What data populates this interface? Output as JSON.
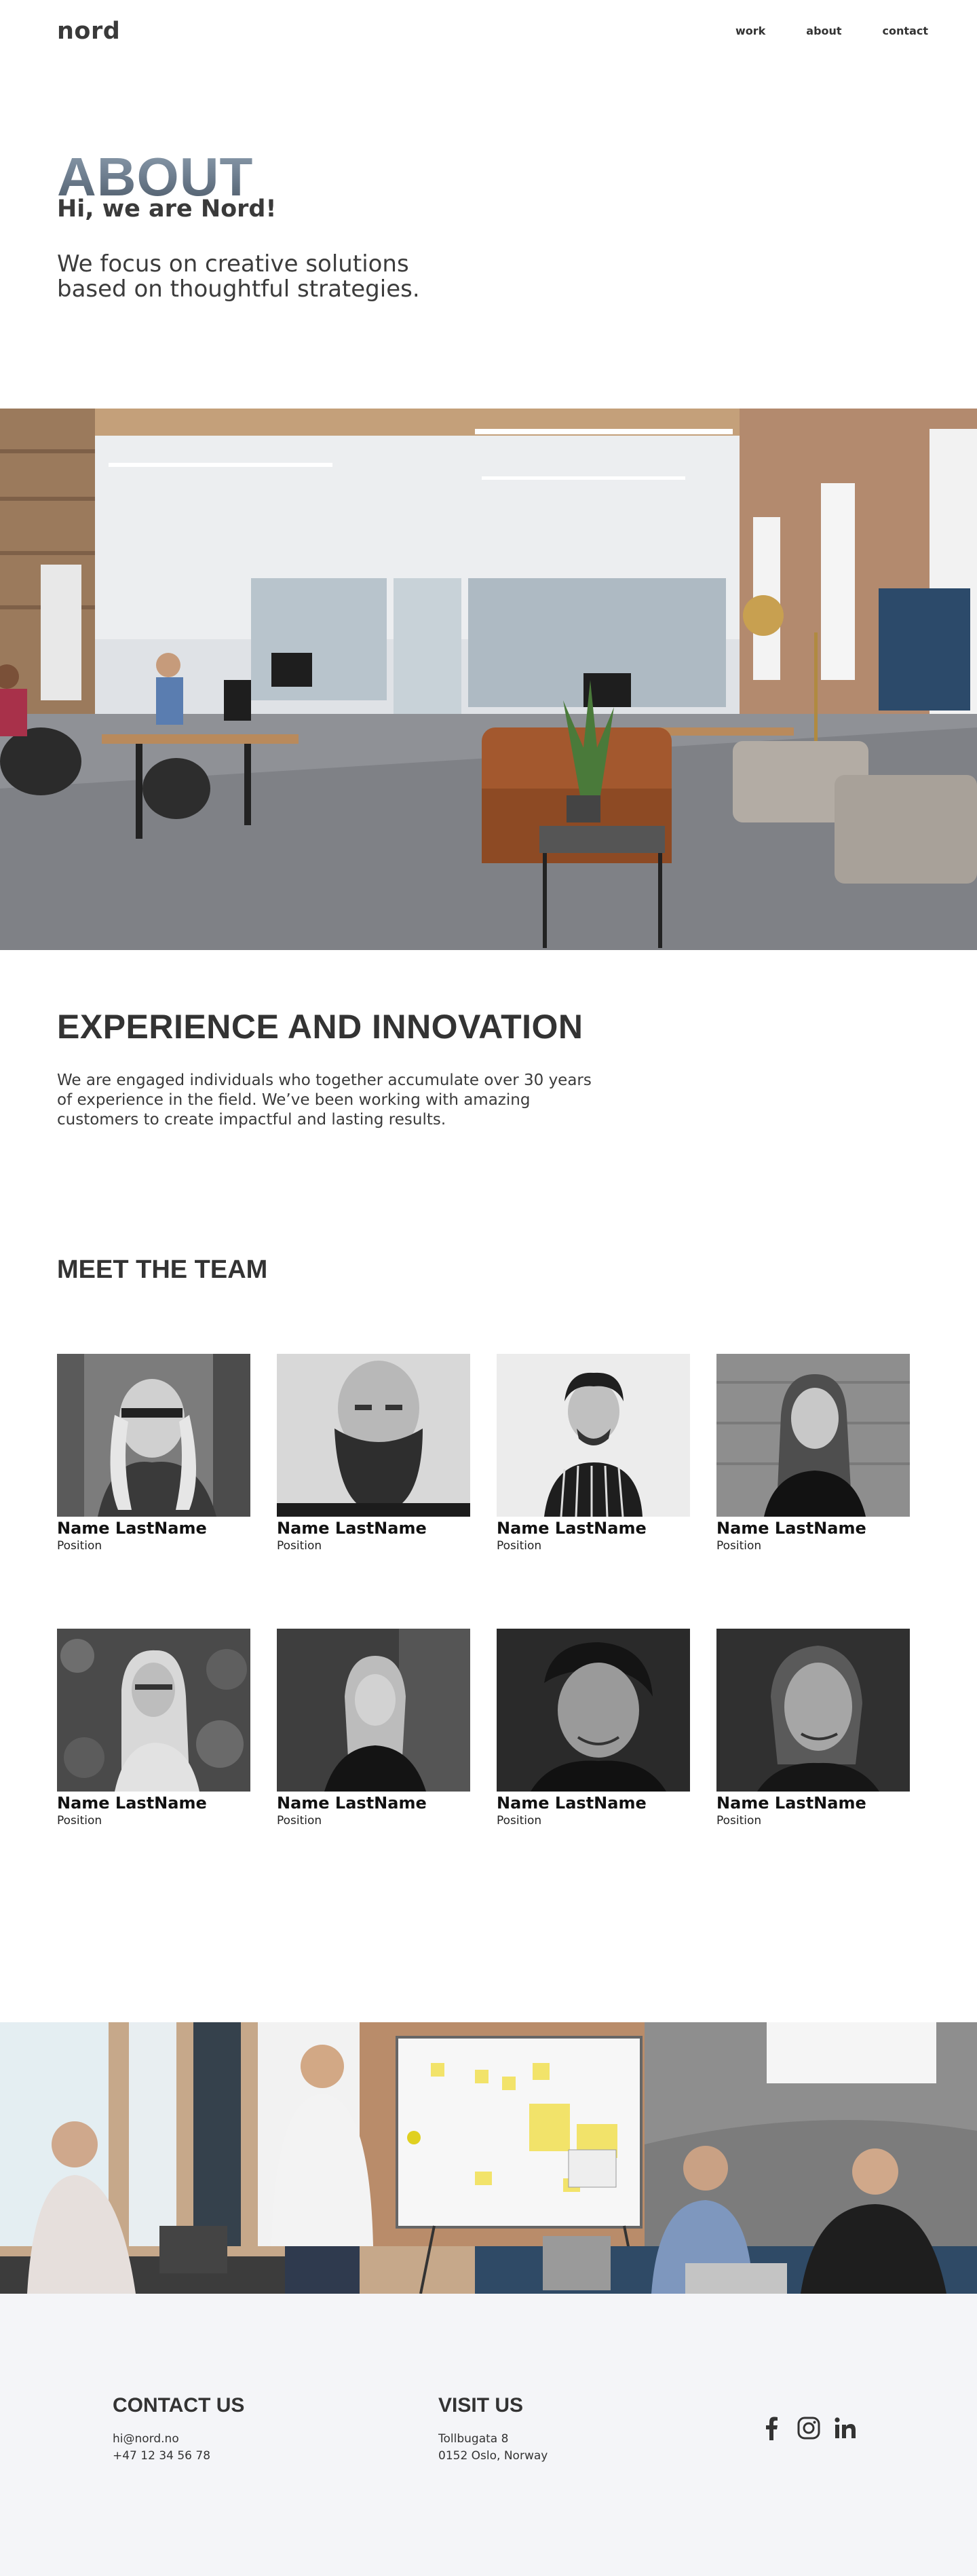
{
  "header": {
    "logo": "nord",
    "nav": [
      {
        "label": "work"
      },
      {
        "label": "about"
      },
      {
        "label": "contact"
      }
    ]
  },
  "hero": {
    "title": "ABOUT",
    "subtitle": "Hi, we are Nord!",
    "tagline": "We focus on creative solutions based on thoughtful strategies."
  },
  "office_photo": {
    "icon": "office-photo"
  },
  "experience": {
    "title": "EXPERIENCE AND INNOVATION",
    "text": "We are engaged individuals who together accumulate over 30 years of experience in the field. We’ve been working with amazing customers to create impactful and lasting results."
  },
  "team": {
    "title": "MEET THE TEAM",
    "members": [
      {
        "name": "Name LastName",
        "position": "Position"
      },
      {
        "name": "Name LastName",
        "position": "Position"
      },
      {
        "name": "Name LastName",
        "position": "Position"
      },
      {
        "name": "Name LastName",
        "position": "Position"
      },
      {
        "name": "Name LastName",
        "position": "Position"
      },
      {
        "name": "Name LastName",
        "position": "Position"
      },
      {
        "name": "Name LastName",
        "position": "Position"
      },
      {
        "name": "Name LastName",
        "position": "Position"
      }
    ]
  },
  "meeting_photo": {
    "icon": "meeting-photo"
  },
  "footer": {
    "background": "#f4f5f8",
    "contact": {
      "title": "CONTACT US",
      "email": "hi@nord.no",
      "phone": "+47 12 34 56 78"
    },
    "visit": {
      "title": "VISIT US",
      "street": "Tollbugata 8",
      "city": "0152 Oslo, Norway"
    },
    "social": [
      {
        "icon": "facebook-icon"
      },
      {
        "icon": "instagram-icon"
      },
      {
        "icon": "linkedin-icon"
      }
    ]
  }
}
